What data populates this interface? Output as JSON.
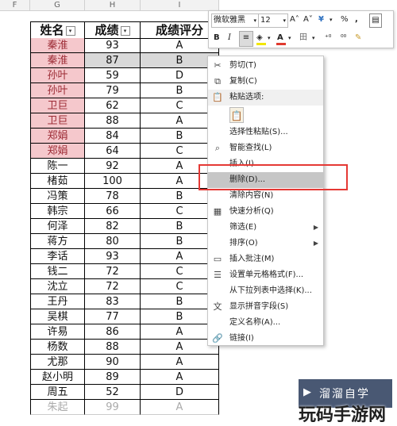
{
  "sheet": {
    "row_header_label": "F",
    "column_headers": [
      "G",
      "H",
      "I"
    ],
    "headers": {
      "name": "姓名",
      "score": "成绩",
      "grade": "成绩评分",
      "filter_glyph": "▾"
    },
    "rows": [
      {
        "name": "秦淮",
        "score": "93",
        "grade": "A"
      },
      {
        "name": "秦淮",
        "score": "87",
        "grade": "B"
      },
      {
        "name": "孙叶",
        "score": "59",
        "grade": "D"
      },
      {
        "name": "孙叶",
        "score": "79",
        "grade": "B"
      },
      {
        "name": "卫巨",
        "score": "62",
        "grade": "C"
      },
      {
        "name": "卫巨",
        "score": "88",
        "grade": "A"
      },
      {
        "name": "郑娟",
        "score": "84",
        "grade": "B"
      },
      {
        "name": "郑娟",
        "score": "64",
        "grade": "C"
      },
      {
        "name": "陈一",
        "score": "92",
        "grade": "A"
      },
      {
        "name": "楮茹",
        "score": "100",
        "grade": "A"
      },
      {
        "name": "冯策",
        "score": "78",
        "grade": "B"
      },
      {
        "name": "韩宗",
        "score": "66",
        "grade": "C"
      },
      {
        "name": "何泽",
        "score": "82",
        "grade": "B"
      },
      {
        "name": "蒋方",
        "score": "80",
        "grade": "B"
      },
      {
        "name": "李话",
        "score": "93",
        "grade": "A"
      },
      {
        "name": "钱二",
        "score": "72",
        "grade": "C"
      },
      {
        "name": "沈立",
        "score": "72",
        "grade": "C"
      },
      {
        "name": "王丹",
        "score": "83",
        "grade": "B"
      },
      {
        "name": "吴棋",
        "score": "77",
        "grade": "B"
      },
      {
        "name": "许易",
        "score": "86",
        "grade": "A"
      },
      {
        "name": "杨数",
        "score": "88",
        "grade": "A"
      },
      {
        "name": "尤那",
        "score": "90",
        "grade": "A"
      },
      {
        "name": "赵小明",
        "score": "89",
        "grade": "A"
      },
      {
        "name": "周五",
        "score": "52",
        "grade": "D"
      },
      {
        "name": "朱起",
        "score": "99",
        "grade": "A"
      }
    ]
  },
  "mini_toolbar": {
    "font_name": "微软雅黑",
    "font_size": "12",
    "grow_font": "A˄",
    "shrink_font": "A˅",
    "currency": "¥",
    "percent": "%",
    "comma": ",",
    "bold": "B",
    "italic": "I",
    "align": "≡",
    "font_color": "A",
    "border": "田",
    "inc_decimal": "⁺⁰",
    "dec_decimal": "⁰⁰"
  },
  "context_menu": {
    "items": [
      {
        "label": "剪切(T)",
        "icon": "✂"
      },
      {
        "label": "复制(C)",
        "icon": "⧉"
      },
      {
        "label": "粘贴选项:",
        "icon": "📋"
      },
      {
        "label": "选择性粘贴(S)...",
        "icon": ""
      },
      {
        "label": "智能查找(L)",
        "icon": "⌕"
      },
      {
        "label": "插入(I)...",
        "icon": ""
      },
      {
        "label": "删除(D)...",
        "icon": ""
      },
      {
        "label": "清除内容(N)",
        "icon": ""
      },
      {
        "label": "快速分析(Q)",
        "icon": "▦"
      },
      {
        "label": "筛选(E)",
        "icon": ""
      },
      {
        "label": "排序(O)",
        "icon": ""
      },
      {
        "label": "插入批注(M)",
        "icon": "▭"
      },
      {
        "label": "设置单元格格式(F)...",
        "icon": "☰"
      },
      {
        "label": "从下拉列表中选择(K)...",
        "icon": ""
      },
      {
        "label": "显示拼音字段(S)",
        "icon": "文"
      },
      {
        "label": "定义名称(A)...",
        "icon": ""
      },
      {
        "label": "链接(I)",
        "icon": "🔗"
      }
    ],
    "submenu_arrow": "▶"
  },
  "watermark": {
    "badge": "溜溜自学",
    "brand": "玩码手游网"
  },
  "colors": {
    "highlight_red": "#e53935",
    "pink_fill": "#f5c8cc",
    "pink_text": "#9c2b35"
  }
}
